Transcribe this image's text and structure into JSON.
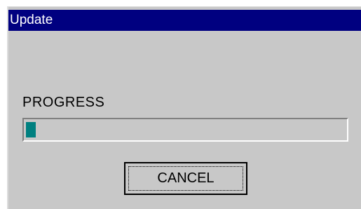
{
  "window": {
    "title": "Update"
  },
  "progress": {
    "label": "PROGRESS",
    "value_fraction": 0.03,
    "fill_color": "#008080"
  },
  "buttons": {
    "cancel_label": "CANCEL"
  },
  "colors": {
    "title_bar": "#000080",
    "dialog_bg": "#c8c8c8"
  }
}
